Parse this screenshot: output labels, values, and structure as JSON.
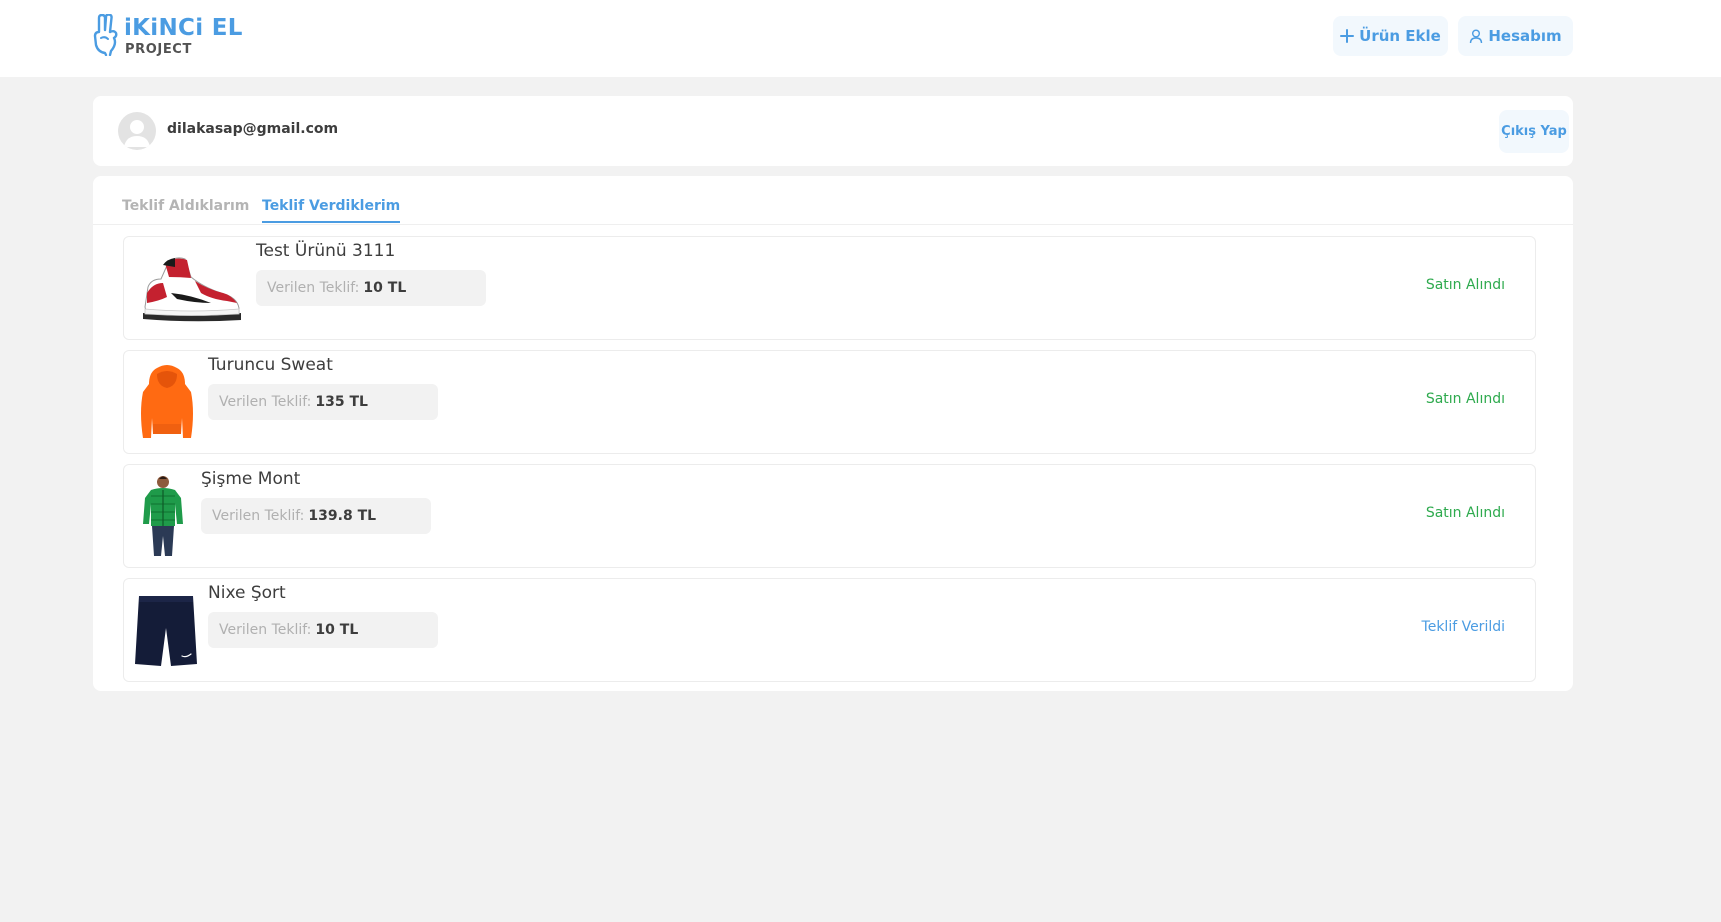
{
  "header": {
    "logo_top": "iKiNCi EL",
    "logo_bottom": "PROJECT",
    "add_product_label": "Ürün Ekle",
    "account_label": "Hesabım"
  },
  "user": {
    "email": "dilakasap@gmail.com",
    "logout_label": "Çıkış Yap"
  },
  "tabs": [
    {
      "label": "Teklif Aldıklarım",
      "active": false
    },
    {
      "label": "Teklif Verdiklerim",
      "active": true
    }
  ],
  "offer_label": "Verilen Teklif:",
  "offers": [
    {
      "product": "Test Ürünü 3111",
      "amount": "10 TL",
      "status": "Satın Alındı",
      "status_color": "#2eaa4e",
      "image": "sneaker-image"
    },
    {
      "product": "Turuncu Sweat",
      "amount": "135 TL",
      "status": "Satın Alındı",
      "status_color": "#2eaa4e",
      "image": "orange-hoodie-image"
    },
    {
      "product": "Şişme Mont",
      "amount": "139.8 TL",
      "status": "Satın Alındı",
      "status_color": "#2eaa4e",
      "image": "green-jacket-image"
    },
    {
      "product": "Nixe Şort",
      "amount": "10 TL",
      "status": "Teklif Verildi",
      "status_color": "#4b9ce2",
      "image": "navy-shorts-image"
    }
  ],
  "colors": {
    "accent": "#4b9ce2",
    "success": "#2eaa4e",
    "background": "#f2f2f2"
  }
}
